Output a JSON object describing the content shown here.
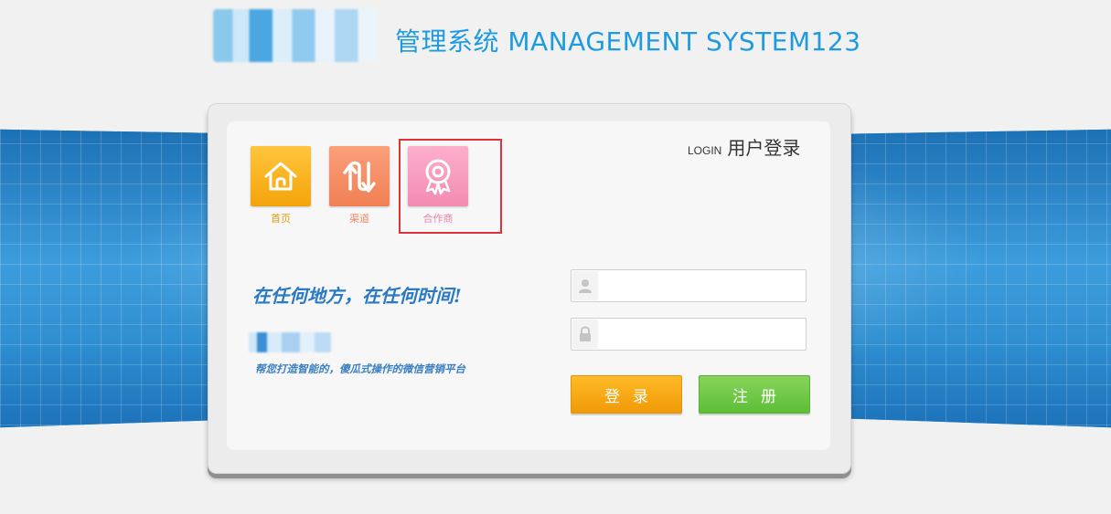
{
  "header": {
    "site_title": "管理系统 MANAGEMENT SYSTEM123"
  },
  "login_panel": {
    "heading_small": "LOGIN",
    "heading_big": "用户登录"
  },
  "tiles": [
    {
      "label": "首页",
      "icon": "home-icon"
    },
    {
      "label": "渠道",
      "icon": "arrows-up-down-icon"
    },
    {
      "label": "合作商",
      "icon": "award-ribbon-icon"
    }
  ],
  "promo": {
    "slogan": "在任何地方，在任何时间!",
    "tagline": "帮您打造智能的，傻瓜式操作的微信营销平台"
  },
  "form": {
    "username_placeholder": "",
    "password_placeholder": "",
    "login_label": "登录",
    "register_label": "注册"
  },
  "colors": {
    "title": "#1e9be0",
    "login_button": "#f5a310",
    "register_button": "#6ac945",
    "highlight": "#e0323a"
  }
}
